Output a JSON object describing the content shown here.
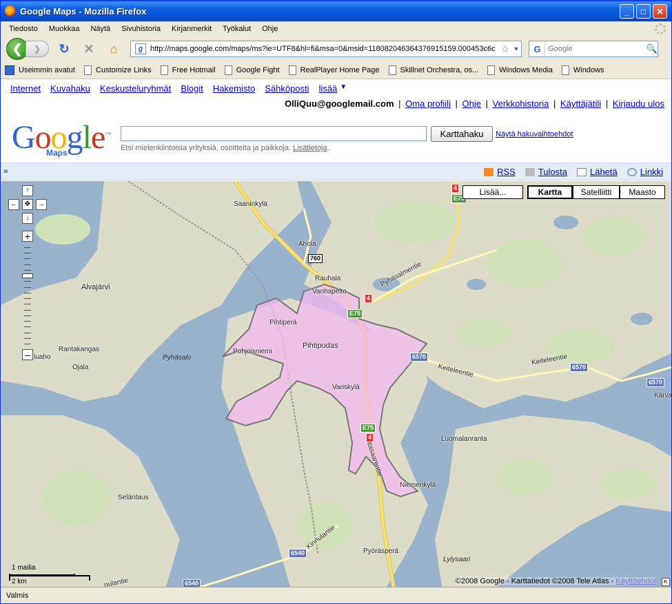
{
  "window": {
    "title": "Google Maps - Mozilla Firefox",
    "controls": {
      "minimize": "_",
      "maximize": "□",
      "close": "✕"
    }
  },
  "menubar": [
    "Tiedosto",
    "Muokkaa",
    "Näytä",
    "Sivuhistoria",
    "Kirjanmerkit",
    "Työkalut",
    "Ohje"
  ],
  "toolbar": {
    "back": "❮",
    "forward": "❯",
    "reload": "↻",
    "stop": "✕",
    "home": "⌂",
    "site_icon": "g",
    "url": "http://maps.google.com/maps/ms?ie=UTF8&hl=fi&msa=0&msid=118082046364376915159.000453c6c",
    "star": "☆",
    "url_dropdown": "▼",
    "search_engine": "G",
    "search_placeholder": "Google",
    "search_go": "🔍"
  },
  "bookmarks": [
    {
      "label": "Useimmin avatut",
      "icon": "bookmarks-folder-icon"
    },
    {
      "label": "Customize Links",
      "icon": "page-icon"
    },
    {
      "label": "Free Hotmail",
      "icon": "page-icon"
    },
    {
      "label": "Google Fight",
      "icon": "page-icon"
    },
    {
      "label": "RealPlayer Home Page",
      "icon": "page-icon"
    },
    {
      "label": "Skillnet Orchestra, os...",
      "icon": "page-icon"
    },
    {
      "label": "Windows Media",
      "icon": "page-icon"
    },
    {
      "label": "Windows",
      "icon": "page-icon"
    }
  ],
  "gbar": {
    "links": [
      "Internet",
      "Kuvahaku",
      "Keskusteluryhmät",
      "Blogit",
      "Hakemisto",
      "Sähköposti",
      "lisää"
    ],
    "more_arrow": "▼"
  },
  "user": {
    "email": "OlliQuu@googlemail.com",
    "links": [
      "Oma profiili",
      "Ohje",
      "Verkkohistoria",
      "Käyttäjätili",
      "Kirjaudu ulos"
    ],
    "separator": "|"
  },
  "logo": {
    "word": "Google",
    "tm": "™",
    "sub": "Maps"
  },
  "search": {
    "value": "",
    "button": "Karttahaku",
    "options": "Näytä hakuvaihtoehdot",
    "hint": "Etsi mielenkiintoisia yrityksiä, osoitteita ja paikkoja.",
    "hint_link": "Lisätietoja"
  },
  "mapbar": {
    "collapse": "»",
    "links": [
      {
        "label": "RSS",
        "icon": "rss-icon"
      },
      {
        "label": "Tulosta",
        "icon": "print-icon"
      },
      {
        "label": "Lähetä",
        "icon": "mail-icon"
      },
      {
        "label": "Linkki",
        "icon": "link-icon"
      }
    ]
  },
  "map": {
    "types": {
      "more": "Lisää...",
      "map": "Kartta",
      "satellite": "Satelliitti",
      "terrain": "Maasto"
    },
    "active_type": "Kartta",
    "pan": {
      "up": "↑",
      "left": "←",
      "center": "✥",
      "right": "→",
      "down": "↓"
    },
    "zoom": {
      "in": "+",
      "out": "–"
    },
    "zoom_level_fraction": 0.3,
    "scale": {
      "imperial": "1 mailia",
      "metric": "2 km"
    },
    "copyright": "©2008 Google - Karttatiedot ©2008 Tele Atlas -",
    "terms": "Käyttöehdot",
    "resize": "⇱",
    "labels": {
      "saaninkyla": "Saaninkylä",
      "ahola": "Ahola",
      "alvajarvi": "Alvajärvi",
      "rauhala": "Rauhala",
      "vanhapelto": "Vanhapelto",
      "pyhasalmentie": "Pyhäsalmentie",
      "pihtipera": "Pihtiperä",
      "pihtipudas": "Pihtipudas",
      "pohjoisniemi": "Pohjoisniemi",
      "rantakangas": "Rantakangas",
      "pyhasalo": "Pyhäsalo",
      "muaho": "luaho",
      "ojala": "Ojala",
      "keitelee1": "Keiteleentie",
      "keitelee2": "Keiteleentie",
      "karva": "Kärva",
      "variskyla": "Variskylä",
      "luomalanranta": "Luomalanranta",
      "vitasaarentie": "Vitasaarentie",
      "selantaus": "Seläntaus",
      "niemenkyla": "Niemenkylä",
      "kinnulantie": "Kinnulantie",
      "kinnulantie2": "nulantie",
      "pyorasperra": "Pyöräsperä",
      "lylysaari": "Lylysaari"
    },
    "shields": {
      "r4_top": "4",
      "e75_top": "E75",
      "r760": "760",
      "r4_mid": "4",
      "e75_mid": "E75",
      "r6570_a": "6570",
      "r6570_b": "6570",
      "r6570_c": "6570",
      "e75_low": "E75",
      "r4_low": "4",
      "r6540_a": "6540",
      "r6540_b": "6540"
    },
    "colors": {
      "water": "#99b3cc",
      "land": "#dcdcc8",
      "forest": "#cfe2b8",
      "area": "#f4b8f0",
      "road_main": "#f5e07a",
      "road": "#fff6b8"
    }
  },
  "status": "Valmis"
}
